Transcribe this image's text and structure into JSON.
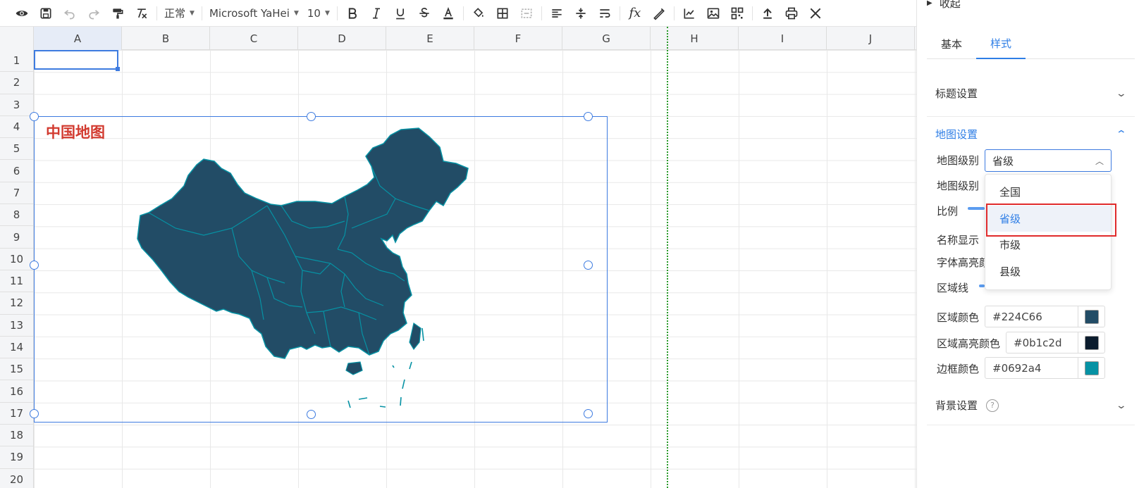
{
  "toolbar": {
    "style_select": "正常",
    "font_select": "Microsoft YaHei",
    "size_select": "10"
  },
  "sheet": {
    "columns": [
      "A",
      "B",
      "C",
      "D",
      "E",
      "F",
      "G",
      "H",
      "I",
      "J"
    ],
    "rows": [
      "1",
      "2",
      "3",
      "4",
      "5",
      "6",
      "7",
      "8",
      "9",
      "10",
      "11",
      "12",
      "13",
      "14",
      "15",
      "16",
      "17",
      "18",
      "19",
      "20"
    ]
  },
  "chart": {
    "title": "中国地图",
    "area_color": "#224C66",
    "border_color": "#0692a4"
  },
  "panel": {
    "collapse_label": "收起",
    "tabs": [
      {
        "label": "基本"
      },
      {
        "label": "样式"
      }
    ],
    "sections": {
      "title_settings": "标题设置",
      "map_settings": "地图设置",
      "background_settings": "背景设置"
    },
    "map_level_label": "地图级别",
    "map_level_value": "省级",
    "map_level_label2": "地图级别",
    "scale_label": "比例",
    "name_display_label": "名称显示",
    "font_highlight_label": "字体高亮颜",
    "region_line_label": "区域线",
    "region_color_label": "区域颜色",
    "region_color_value": "#224C66",
    "region_highlight_label": "区域高亮颜色",
    "region_highlight_value": "#0b1c2d",
    "border_color_label": "边框颜色",
    "border_color_value": "#0692a4",
    "dropdown_options": [
      {
        "label": "全国"
      },
      {
        "label": "省级"
      },
      {
        "label": "市级"
      },
      {
        "label": "县级"
      }
    ]
  }
}
